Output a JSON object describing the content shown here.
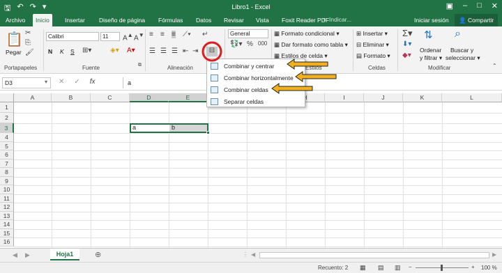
{
  "window": {
    "title": "Libro1 - Excel"
  },
  "tabs": [
    "Archivo",
    "Inicio",
    "Insertar",
    "Diseño de página",
    "Fórmulas",
    "Datos",
    "Revisar",
    "Vista",
    "Foxit Reader PDF"
  ],
  "tellme": "Indicar...",
  "signin": "Iniciar sesión",
  "share": "Compartir",
  "ribbon": {
    "paste": "Pegar",
    "font_name": "Calibri",
    "font_size": "11",
    "bold": "N",
    "italic": "K",
    "underline": "S",
    "number_format": "General",
    "cond_format": "Formato condicional",
    "table_format": "Dar formato como tabla",
    "cell_styles": "Estilos de celda",
    "insert": "Insertar",
    "delete": "Eliminar",
    "format": "Formato",
    "sort_filter_1": "Ordenar",
    "sort_filter_2": "y filtrar",
    "find_1": "Buscar y",
    "find_2": "seleccionar",
    "groups": {
      "clipboard": "Portapapeles",
      "font": "Fuente",
      "alignment": "Alineación",
      "styles": "Estilos",
      "cells": "Celdas",
      "modify": "Modificar"
    }
  },
  "formula": {
    "namebox": "D3",
    "content": "a"
  },
  "columns": [
    "A",
    "B",
    "C",
    "D",
    "E",
    "F",
    "G",
    "H",
    "I",
    "J",
    "K",
    "L"
  ],
  "rows": [
    "1",
    "2",
    "3",
    "4",
    "5",
    "6",
    "7",
    "8",
    "9",
    "10",
    "11",
    "12",
    "13",
    "14",
    "15",
    "16"
  ],
  "cells": {
    "D3": "a",
    "E3": "b"
  },
  "merge_menu": {
    "items": [
      "Combinar y centrar",
      "Combinar horizontalmente",
      "Combinar celdas",
      "Separar celdas"
    ]
  },
  "sheet": {
    "tab": "Hoja1"
  },
  "status": {
    "count_label": "Recuento: 2",
    "zoom": "100 %"
  },
  "colors": {
    "excel_green": "#217346",
    "arrow": "#f2b01e",
    "circle": "#e01b1b"
  }
}
